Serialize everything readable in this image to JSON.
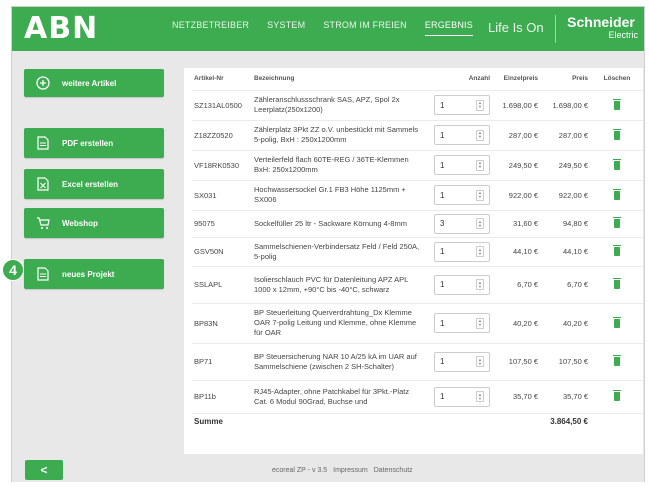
{
  "brand": {
    "logo": "ABN",
    "tagline": "Life Is On",
    "company_top": "Schneider",
    "company_bottom": "Electric",
    "accent_color": "#3dab4f"
  },
  "nav": {
    "items": [
      "NETZBETREIBER",
      "SYSTEM",
      "STROM IM FREIEN",
      "ERGEBNIS"
    ],
    "active": "ERGEBNIS"
  },
  "sidebar": {
    "add_article": "weitere Artikel",
    "pdf": "PDF erstellen",
    "excel": "Excel erstellen",
    "webshop": "Webshop",
    "new_project": "neues Projekt",
    "step_badge": "4"
  },
  "table": {
    "headers": {
      "article_no": "Artikel-Nr",
      "description": "Bezeichnung",
      "quantity": "Anzahl",
      "unit_price": "Einzelpreis",
      "price": "Preis",
      "delete": "Löschen"
    },
    "rows": [
      {
        "article": "SZ131AL0500",
        "desc": "Zähleranschlussschrank SAS, APZ, Spol 2x Leerplatz(250x1200)",
        "qty": "1",
        "unit": "1.698,00 €",
        "price": "1.698,00 €"
      },
      {
        "article": "Z18ZZ0520",
        "desc": "Zählerplatz 3Pkt ZZ o.V. unbestückt mit Sammels 5-polig, BxH : 250x1200mm",
        "qty": "1",
        "unit": "287,00 €",
        "price": "287,00 €"
      },
      {
        "article": "VF18RK0530",
        "desc": "Verteilerfeld flach 60TE-REG / 36TE-Klemmen BxH: 250x1200mm",
        "qty": "1",
        "unit": "249,50 €",
        "price": "249,50 €"
      },
      {
        "article": "SX031",
        "desc": "Hochwassersockel Gr.1 FB3 Höhe 1125mm + SX006",
        "qty": "1",
        "unit": "922,00 €",
        "price": "922,00 €"
      },
      {
        "article": "95075",
        "desc": "Sockelfüller 25 ltr - Sackware Körnung 4-8mm",
        "qty": "3",
        "unit": "31,60 €",
        "price": "94,80 €"
      },
      {
        "article": "GSV50N",
        "desc": "Sammelschienen-Verbindersatz Feld / Feld 250A, 5-polig",
        "qty": "1",
        "unit": "44,10 €",
        "price": "44,10 €"
      },
      {
        "article": "SSLAPL",
        "desc": "Isolierschlauch PVC für Datenleitung APZ APL 1000 x 12mm, +90°C bis -40°C, schwarz",
        "qty": "1",
        "unit": "6,70 €",
        "price": "6,70 €"
      },
      {
        "article": "BP83N",
        "desc": "BP Steuerleitung Querverdrahtung_Dx Klemme OAR 7-polig Leitung und Klemme, ohne Klemme für OAR",
        "qty": "1",
        "unit": "40,20 €",
        "price": "40,20 €"
      },
      {
        "article": "BP71",
        "desc": "BP Steuersicherung NAR 10 A/25 kA im UAR auf Sammelschiene (zwischen 2 SH-Schalter)",
        "qty": "1",
        "unit": "107,50 €",
        "price": "107,50 €"
      },
      {
        "article": "BP11b",
        "desc": "RJ45-Adapter, ohne Patchkabel für 3Pkt.-Platz Cat. 6 Modul 90Grad, Buchse und",
        "qty": "1",
        "unit": "35,70 €",
        "price": "35,70 €"
      }
    ],
    "sum_label": "Summe",
    "sum_value": "3.864,50 €"
  },
  "footer": {
    "back": "<",
    "version": "ecoreal ZP - v 3.5",
    "imprint": "Impressum",
    "privacy": "Datenschutz"
  }
}
